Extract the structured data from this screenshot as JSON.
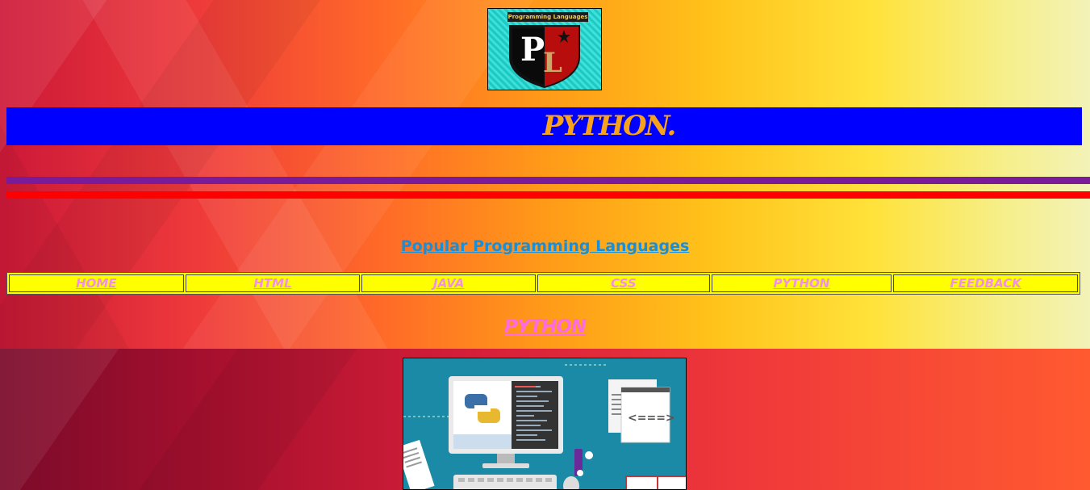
{
  "logo": {
    "ribbon_text": "Programming Languages",
    "letters": "PL"
  },
  "title_bar": {
    "text": "PYTHON."
  },
  "heading": {
    "text": "Popular Programming Languages"
  },
  "nav": {
    "items": [
      {
        "label": "HOME"
      },
      {
        "label": "HTML"
      },
      {
        "label": "JAVA"
      },
      {
        "label": "CSS"
      },
      {
        "label": "PYTHON"
      },
      {
        "label": "FEEDBACK"
      }
    ]
  },
  "subheading": {
    "text": "PYTHON"
  },
  "colors": {
    "title_bar_bg": "#0000ff",
    "title_text": "#f7a21a",
    "nav_bg": "#ffff00",
    "nav_text": "#f28fe3",
    "heading_text": "#1a8ed6",
    "rule_purple": "#7a1b9a",
    "rule_red": "#ff0000"
  }
}
